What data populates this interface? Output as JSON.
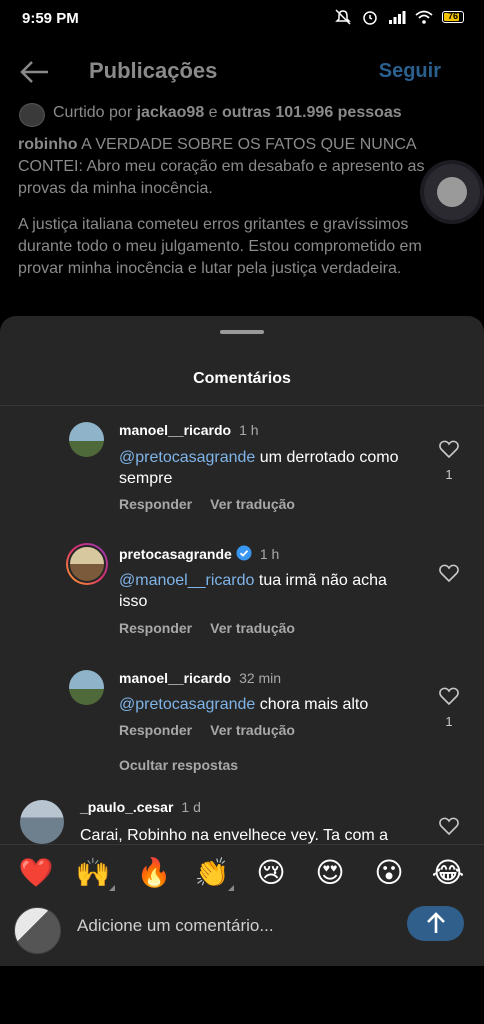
{
  "status_bar": {
    "time": "9:59 PM",
    "battery": "76"
  },
  "header": {
    "title": "Publicações",
    "follow_label": "Seguir"
  },
  "post": {
    "liked_prefix": "Curtido por",
    "liked_user": "jackao98",
    "liked_and": "e",
    "liked_others": "outras 101.996 pessoas",
    "author": "robinho",
    "caption_1": "A VERDADE SOBRE OS FATOS QUE NUNCA CONTEI: Abro meu coração em desabafo e apresento as provas da minha inocência.",
    "caption_2": "A justiça italiana cometeu erros gritantes e gravíssimos durante todo o meu julgamento. Estou comprometido em provar minha inocência e lutar pela justiça verdadeira."
  },
  "comments_sheet": {
    "title": "Comentários",
    "reply_label": "Responder",
    "translate_label": "Ver tradução",
    "hide_replies_label": "Ocultar respostas",
    "replies": [
      {
        "user": "manoel__ricardo",
        "time": "1 h",
        "mention": "@pretocasagrande",
        "text": " um derrotado como sempre",
        "likes": "1"
      },
      {
        "user": "pretocasagrande",
        "time": "1 h",
        "mention": "@manoel__ricardo",
        "text": " tua irmã não acha isso",
        "likes": ""
      },
      {
        "user": "manoel__ricardo",
        "time": "32 min",
        "mention": "@pretocasagrande",
        "text": " chora mais alto",
        "likes": "1"
      }
    ],
    "next_comment": {
      "user": "_paulo_.cesar",
      "time": "1 d",
      "text": "Carai, Robinho na envelhece vey. Ta com a"
    }
  },
  "emoji_bar": [
    "❤️",
    "🙌",
    "🔥",
    "👏",
    "😢",
    "😍",
    "😮",
    "😂"
  ],
  "composer": {
    "placeholder": "Adicione um comentário..."
  }
}
